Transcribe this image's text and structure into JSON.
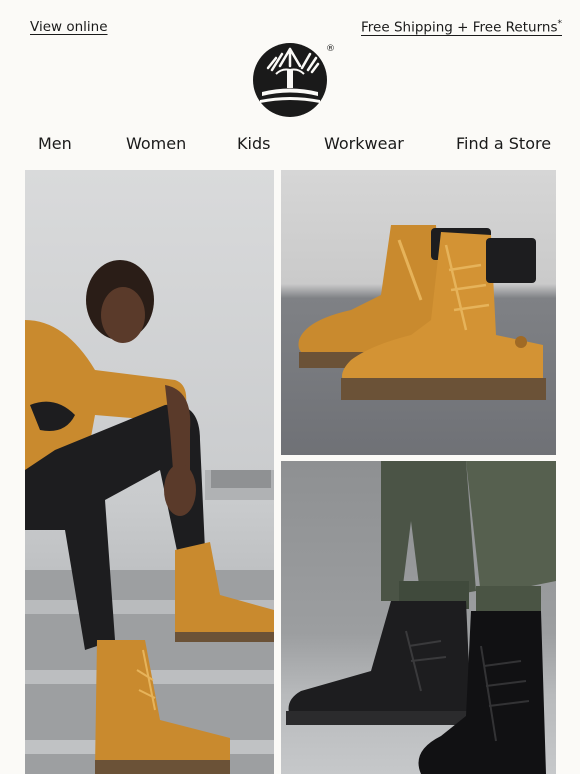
{
  "header": {
    "view_online": "View online",
    "shipping": "Free Shipping + Free Returns",
    "shipping_mark": "*"
  },
  "brand": {
    "logo_icon": "timberland-tree-logo",
    "registered": "®"
  },
  "nav": {
    "items": [
      {
        "label": "Men"
      },
      {
        "label": "Women"
      },
      {
        "label": "Kids"
      },
      {
        "label": "Workwear"
      },
      {
        "label": "Find a Store"
      }
    ]
  },
  "images": [
    {
      "icon": "model-wearing-wheat-boots-photo"
    },
    {
      "icon": "wheat-boots-product-photo"
    },
    {
      "icon": "black-boots-on-feet-photo"
    }
  ],
  "colors": {
    "wheat": "#c98a2e",
    "black_boot": "#1d1d1f",
    "background": "#fbfaf7"
  }
}
